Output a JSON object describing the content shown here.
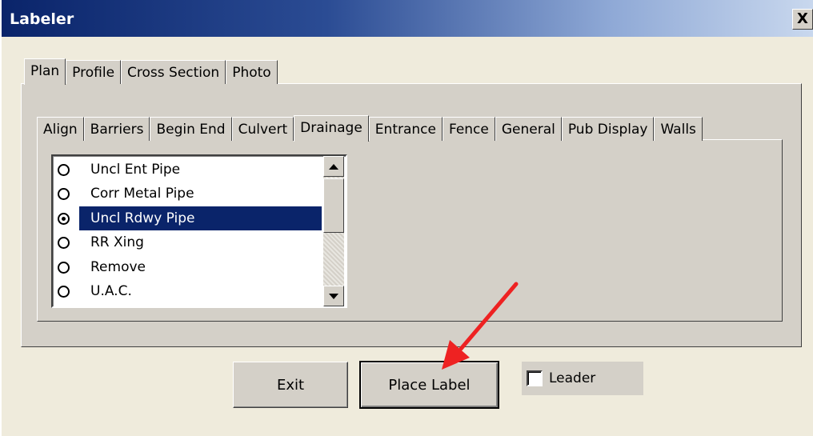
{
  "window": {
    "title": "Labeler",
    "close_glyph": "X"
  },
  "outer_tabs": [
    {
      "label": "Plan",
      "active": true
    },
    {
      "label": "Profile",
      "active": false
    },
    {
      "label": "Cross Section",
      "active": false
    },
    {
      "label": "Photo",
      "active": false
    }
  ],
  "inner_tabs": [
    {
      "label": "Align",
      "active": false
    },
    {
      "label": "Barriers",
      "active": false
    },
    {
      "label": "Begin End",
      "active": false
    },
    {
      "label": "Culvert",
      "active": false
    },
    {
      "label": "Drainage",
      "active": true
    },
    {
      "label": "Entrance",
      "active": false
    },
    {
      "label": "Fence",
      "active": false
    },
    {
      "label": "General",
      "active": false
    },
    {
      "label": "Pub Display",
      "active": false
    },
    {
      "label": "Walls",
      "active": false
    }
  ],
  "list": {
    "items": [
      {
        "label": "Uncl Ent Pipe",
        "checked": false
      },
      {
        "label": "Corr Metal Pipe",
        "checked": false
      },
      {
        "label": "Uncl Rdwy Pipe",
        "checked": true
      },
      {
        "label": "RR Xing",
        "checked": false
      },
      {
        "label": "Remove",
        "checked": false
      },
      {
        "label": "U.A.C.",
        "checked": false
      }
    ],
    "selected_index": 2
  },
  "buttons": {
    "exit_label": "Exit",
    "place_label": "Place Label"
  },
  "leader": {
    "label": "Leader",
    "checked": false
  },
  "annotation": {
    "arrow_color": "#ee2222"
  }
}
